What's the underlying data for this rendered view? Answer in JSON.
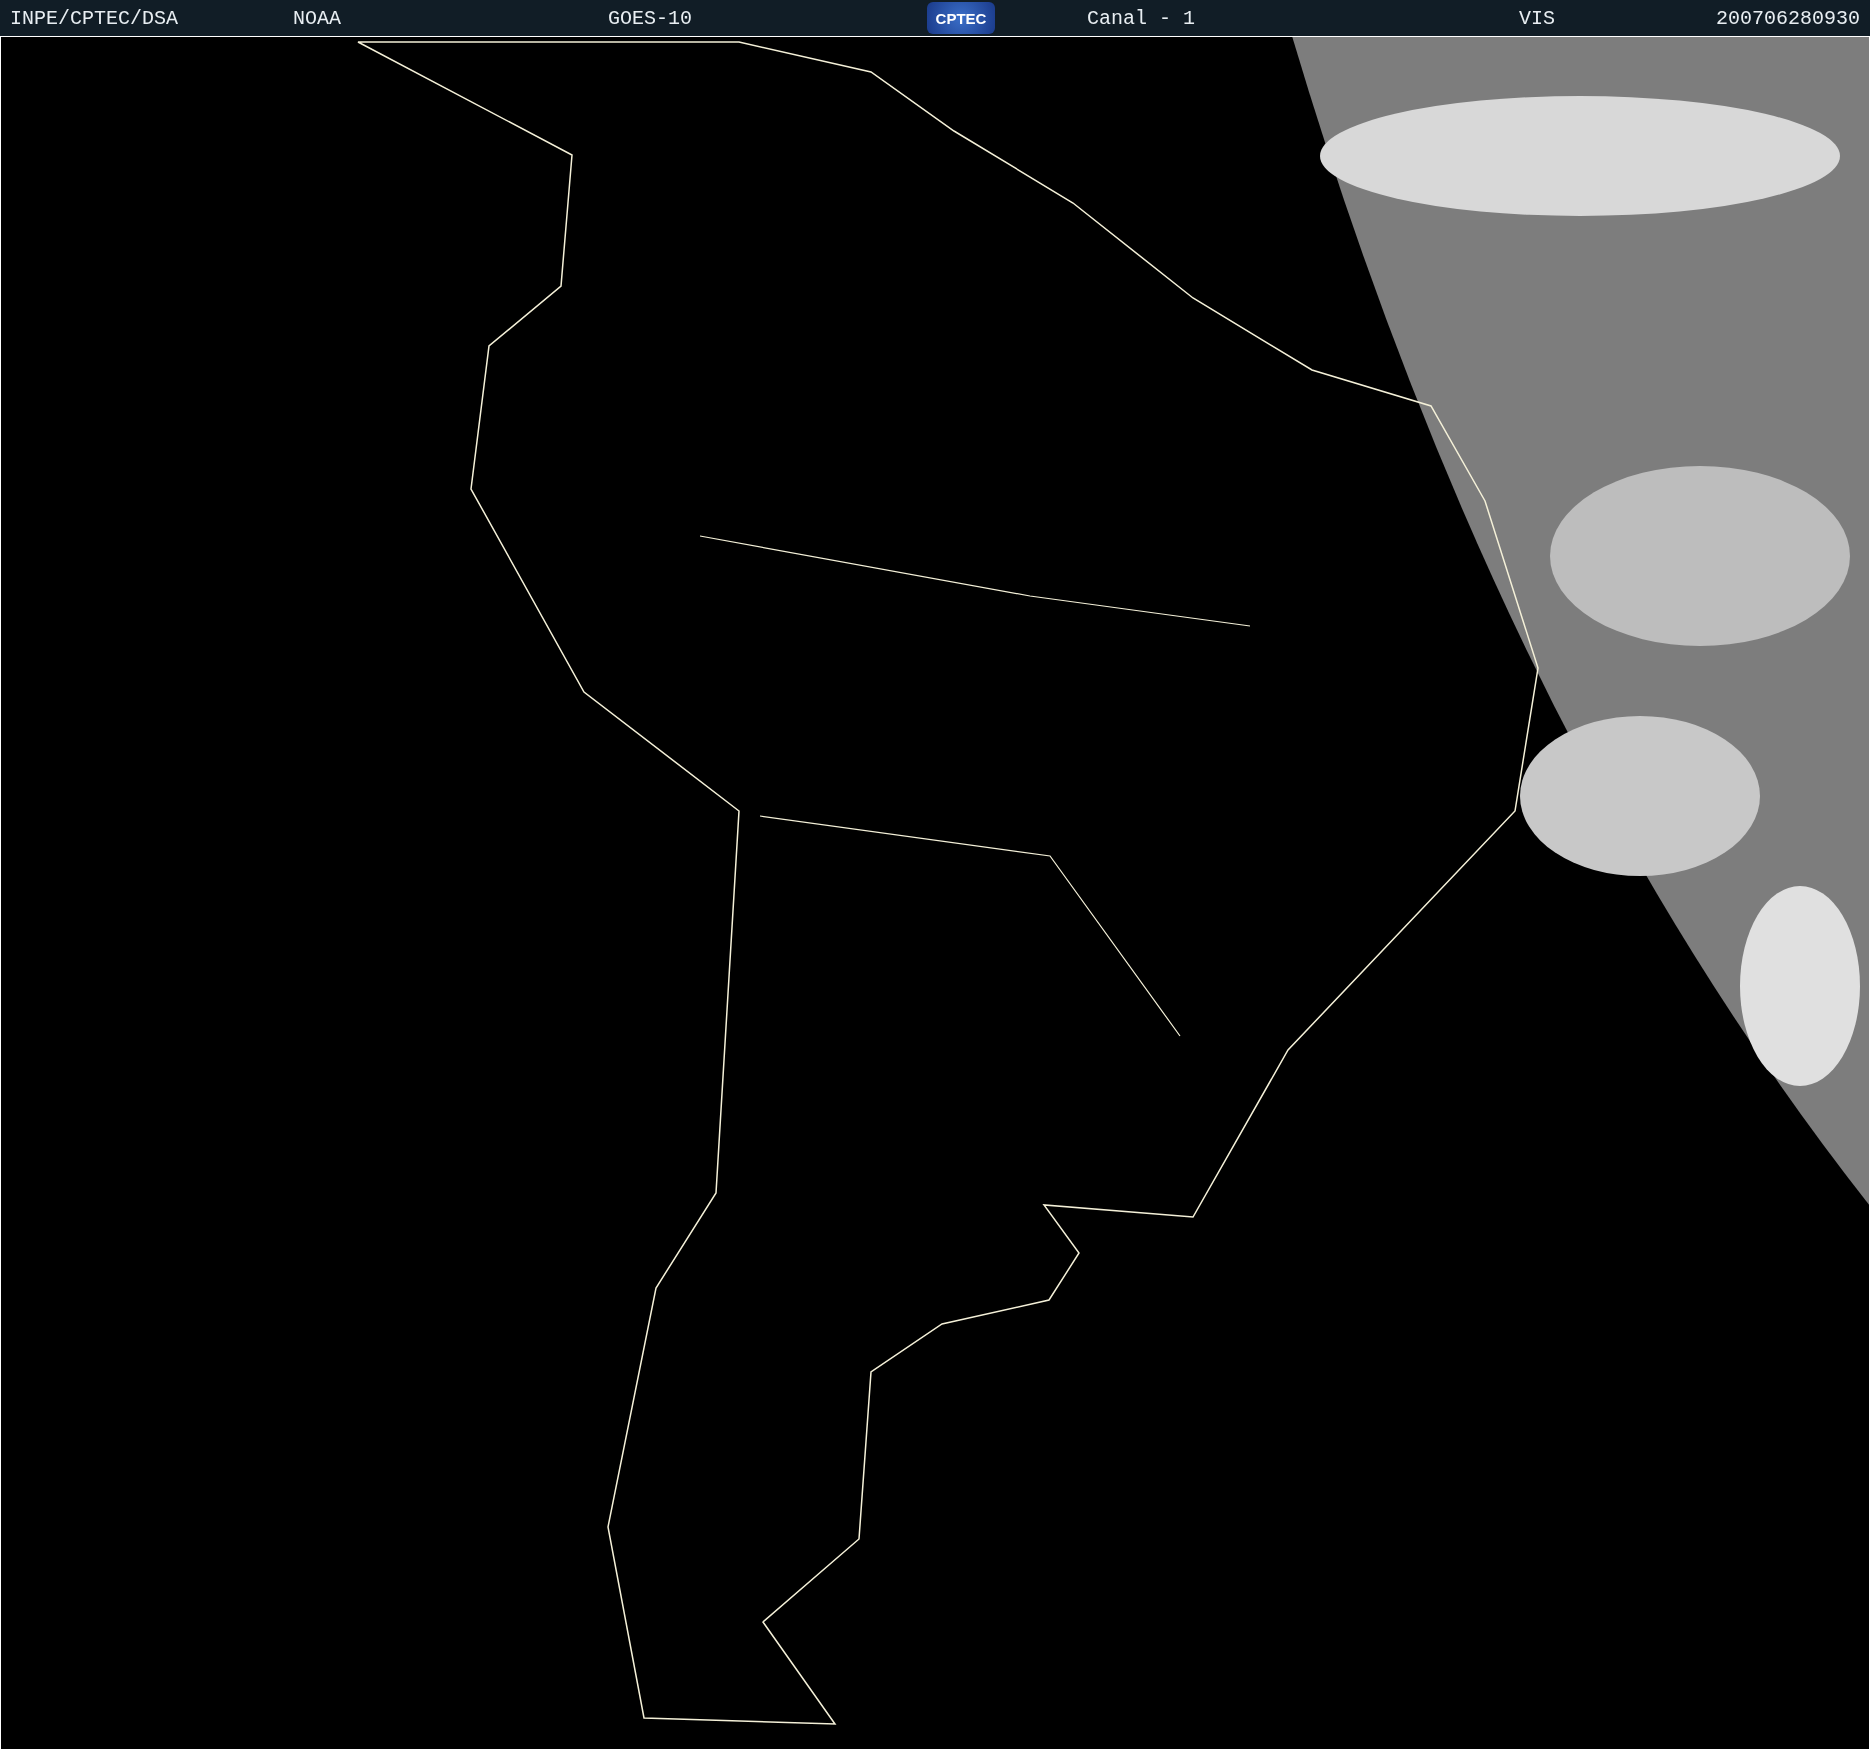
{
  "header": {
    "items": [
      {
        "kind": "text",
        "text": "INPE/CPTEC/DSA"
      },
      {
        "kind": "text",
        "text": "NOAA"
      },
      {
        "kind": "text",
        "text": "GOES-10"
      },
      {
        "kind": "logo",
        "text": "CPTEC"
      },
      {
        "kind": "text",
        "text": "Canal - 1"
      },
      {
        "kind": "text",
        "text": "VIS"
      },
      {
        "kind": "text",
        "text": "200706280930"
      }
    ]
  }
}
